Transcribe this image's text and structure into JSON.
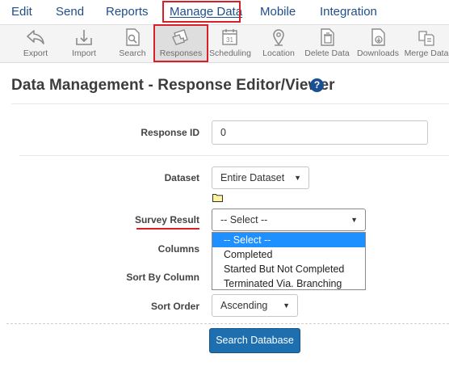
{
  "menu": {
    "items": [
      {
        "label": "Edit"
      },
      {
        "label": "Send"
      },
      {
        "label": "Reports"
      },
      {
        "label": "Manage Data"
      },
      {
        "label": "Mobile"
      },
      {
        "label": "Integration"
      }
    ],
    "active": "Manage Data"
  },
  "toolbar": {
    "items": [
      {
        "label": "Export",
        "icon": "export-icon"
      },
      {
        "label": "Import",
        "icon": "import-icon"
      },
      {
        "label": "Search",
        "icon": "search-icon"
      },
      {
        "label": "Responses",
        "icon": "responses-icon"
      },
      {
        "label": "Scheduling",
        "icon": "calendar-icon"
      },
      {
        "label": "Location",
        "icon": "location-pin-icon"
      },
      {
        "label": "Delete Data",
        "icon": "delete-data-icon"
      },
      {
        "label": "Downloads",
        "icon": "downloads-icon"
      },
      {
        "label": "Merge Data",
        "icon": "merge-data-icon"
      }
    ],
    "selected": "Responses"
  },
  "page": {
    "title": "Data Management - Response Editor/Viewer",
    "help_icon": "?"
  },
  "form": {
    "response_id": {
      "label": "Response ID",
      "value": "0"
    },
    "dataset": {
      "label": "Dataset",
      "value": "Entire Dataset"
    },
    "survey_result": {
      "label": "Survey Result",
      "value": "-- Select --",
      "options": [
        "-- Select --",
        "Completed",
        "Started But Not Completed",
        "Terminated Via. Branching"
      ]
    },
    "columns": {
      "label": "Columns"
    },
    "sort_by_column": {
      "label": "Sort By Column"
    },
    "sort_order": {
      "label": "Sort Order",
      "value": "Ascending"
    },
    "search_button": "Search Database"
  },
  "colors": {
    "menu_text": "#1f4e8c",
    "highlight_box": "#d8202a",
    "button_blue": "#1d6fb0",
    "option_highlight": "#1e90ff"
  }
}
